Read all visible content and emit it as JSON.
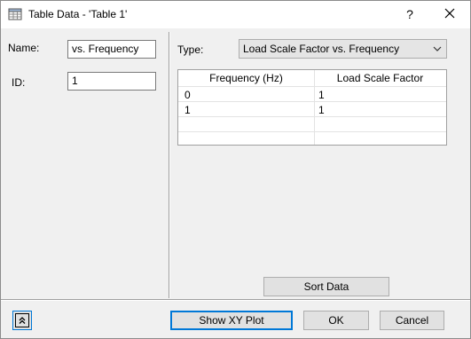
{
  "window": {
    "title": "Table Data - 'Table 1'",
    "help_label": "?"
  },
  "left": {
    "name_label": "Name:",
    "name_value": "vs. Frequency",
    "id_label": "ID:",
    "id_value": "1"
  },
  "right": {
    "type_label": "Type:",
    "type_value": "Load Scale Factor vs. Frequency",
    "table": {
      "headers": [
        "Frequency (Hz)",
        "Load Scale Factor"
      ],
      "rows": [
        [
          "0",
          "1"
        ],
        [
          "1",
          "1"
        ]
      ]
    },
    "sort_label": "Sort Data"
  },
  "footer": {
    "show_xy_label": "Show XY Plot",
    "ok_label": "OK",
    "cancel_label": "Cancel"
  },
  "colors": {
    "focus_border": "#0078d7",
    "dialog_background": "#f0f0f0"
  }
}
